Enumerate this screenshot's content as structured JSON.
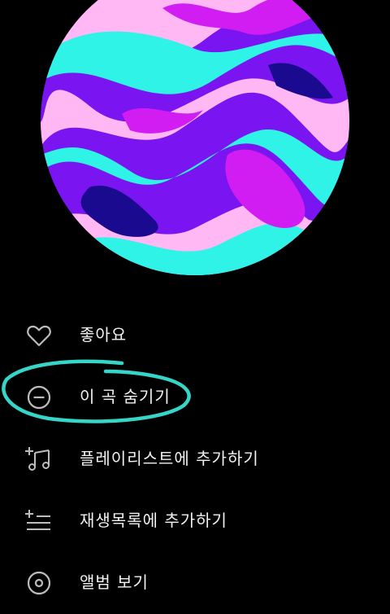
{
  "album_art": {
    "icon": "marble-swirl-artwork",
    "colors": [
      "#2ff3e7",
      "#7a14f0",
      "#ffb8f4",
      "#d21df2",
      "#1a0a8f"
    ]
  },
  "menu": {
    "items": [
      {
        "label": "좋아요",
        "icon": "heart-icon"
      },
      {
        "label": "이 곡 숨기기",
        "icon": "minus-circle-icon"
      },
      {
        "label": "플레이리스트에 추가하기",
        "icon": "add-to-playlist-icon"
      },
      {
        "label": "재생목록에 추가하기",
        "icon": "add-to-queue-icon"
      },
      {
        "label": "앨범 보기",
        "icon": "album-icon"
      }
    ]
  },
  "annotation": {
    "color": "#35d6c8"
  }
}
